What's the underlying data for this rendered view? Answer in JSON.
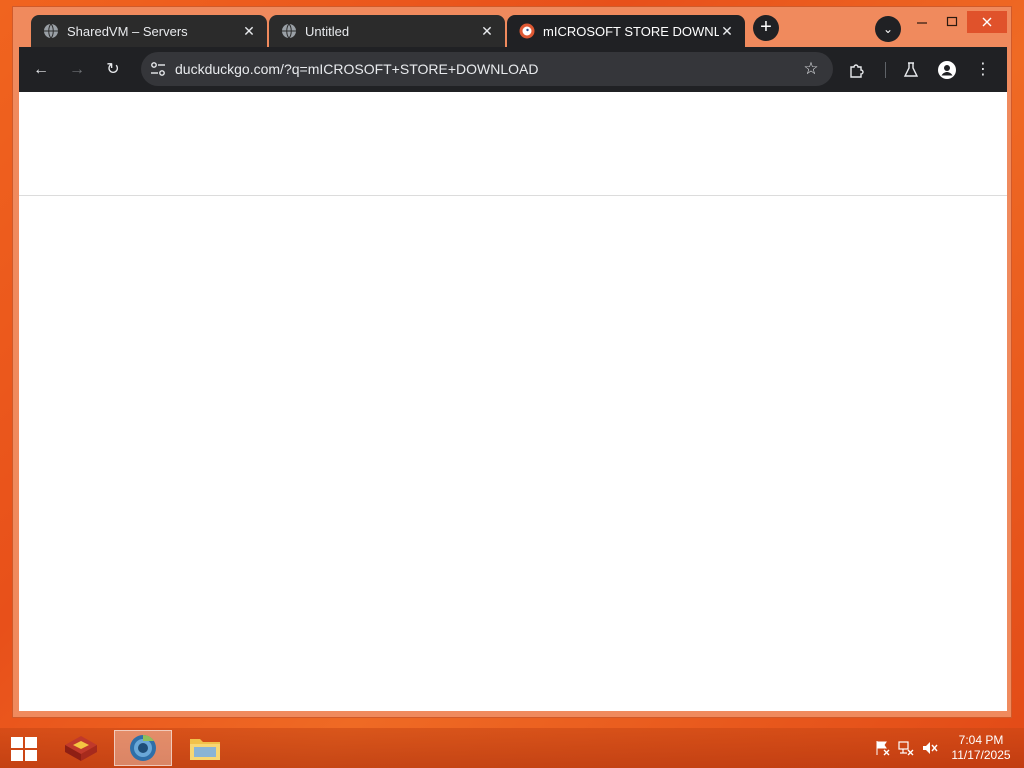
{
  "browser": {
    "tabs": [
      {
        "title": "SharedVM – Servers",
        "active": false,
        "icon": "globe-icon"
      },
      {
        "title": "Untitled",
        "active": false,
        "icon": "globe-icon"
      },
      {
        "title": "mICROSOFT STORE DOWNLOAD",
        "active": true,
        "icon": "duckduckgo-icon"
      }
    ],
    "new_tab_label": "+",
    "address": "duckduckgo.com/?q=mICROSOFT+STORE+DOWNLOAD"
  },
  "taskbar": {
    "apps": [
      "app-icon",
      "chrome-icon",
      "file-explorer-icon"
    ],
    "clock_time": "7:04 PM",
    "clock_date": "11/17/2025"
  },
  "colors": {
    "desktop": "#e8501a",
    "toolbar": "#202124",
    "omnibox": "#35363a",
    "close_button": "#e0522b"
  }
}
